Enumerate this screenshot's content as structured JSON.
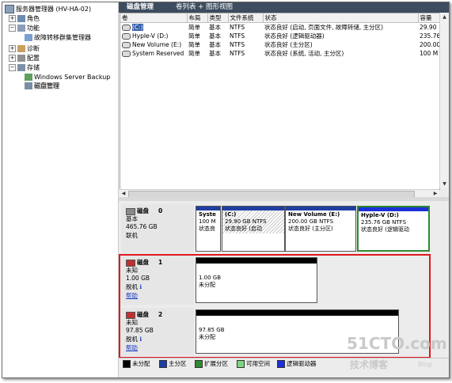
{
  "tree": {
    "root": "服务器管理器 (HV-HA-02)",
    "roles": "角色",
    "features": "功能",
    "failover": "故障转移群集管理器",
    "diagnostics": "诊断",
    "configuration": "配置",
    "storage": "存储",
    "backup": "Windows Server Backup",
    "disk_mgmt": "磁盘管理"
  },
  "header": {
    "title": "磁盘管理",
    "view": "卷列表 + 图形视图"
  },
  "columns": [
    "卷",
    "布局",
    "类型",
    "文件系统",
    "状态",
    "容量"
  ],
  "volumes": [
    {
      "name": "(C:)",
      "layout": "简单",
      "type": "基本",
      "fs": "NTFS",
      "status": "状态良好 (启动, 页面文件, 故障转储, 主分区)",
      "capacity": "29.90"
    },
    {
      "name": "Hyple-V (D:)",
      "layout": "简单",
      "type": "基本",
      "fs": "NTFS",
      "status": "状态良好 (逻辑驱动器)",
      "capacity": "235.76"
    },
    {
      "name": "New Volume (E:)",
      "layout": "简单",
      "type": "基本",
      "fs": "NTFS",
      "status": "状态良好 (主分区)",
      "capacity": "200.00"
    },
    {
      "name": "System Reserved",
      "layout": "简单",
      "type": "基本",
      "fs": "NTFS",
      "status": "状态良好 (系统, 活动, 主分区)",
      "capacity": "100 M"
    }
  ],
  "disk0": {
    "title": "磁盘",
    "num": "0",
    "type": "基本",
    "size": "465.76 GB",
    "state": "联机",
    "parts": [
      {
        "name": "Syste",
        "size": "100 M",
        "status": "状态良"
      },
      {
        "name": "(C:)",
        "size": "29.90 GB NTFS",
        "status": "状态良好 (启动"
      },
      {
        "name": "New Volume  (E:)",
        "size": "200.00 GB NTFS",
        "status": "状态良好 (主分区)"
      },
      {
        "name": "Hyple-V  (D:)",
        "size": "235.76 GB NTFS",
        "status": "状态良好 (逻辑驱动"
      }
    ]
  },
  "disk1": {
    "title": "磁盘",
    "num": "1",
    "type": "未知",
    "size": "1.00 GB",
    "state": "脱机",
    "help": "帮助",
    "part_size": "1.00 GB",
    "part_status": "未分配"
  },
  "disk2": {
    "title": "磁盘",
    "num": "2",
    "type": "未知",
    "size": "97.85 GB",
    "state": "脱机",
    "help": "帮助",
    "part_size": "97.85 GB",
    "part_status": "未分配"
  },
  "legend": [
    {
      "label": "未分配",
      "color": "#000000"
    },
    {
      "label": "主分区",
      "color": "#1f3fa0"
    },
    {
      "label": "扩展分区",
      "color": "#2e8b2e"
    },
    {
      "label": "可用空间",
      "color": "#7cd67c"
    },
    {
      "label": "逻辑驱动器",
      "color": "#1c2fd8"
    }
  ],
  "watermark": {
    "line1": "51CTO.com",
    "line2": "技术博客",
    "line3": "Blog"
  }
}
